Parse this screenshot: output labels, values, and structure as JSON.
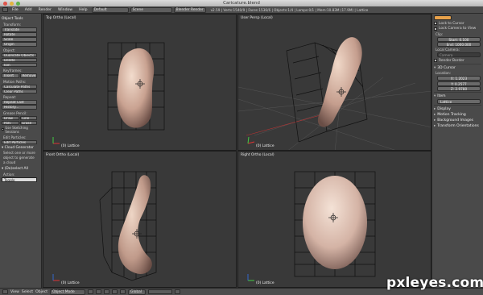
{
  "window": {
    "title": "Caricature.blend"
  },
  "header": {
    "menus": [
      "File",
      "Add",
      "Render",
      "Window",
      "Help"
    ],
    "layout": "Default",
    "scene": "Scene",
    "engine": "Blender Render",
    "stats": "v2.59 | Verts:1540/9 | Faces:1536/6 | Objects:1/4 | Lamps:0/1 | Mem:10.83M (17.9M) | Lattice"
  },
  "shelf": {
    "title": "Object Tools",
    "transform_label": "Transform:",
    "transform": [
      "Translate",
      "Rotate",
      "Scale",
      "Origin"
    ],
    "object_label": "Object:",
    "object": [
      "Duplicate Objects",
      "Delete",
      "Join"
    ],
    "keyframes_label": "Keyframes:",
    "insert": "Insert",
    "remove": "Remove",
    "motion_label": "Motion Paths:",
    "motion": [
      "Calculate Paths",
      "Clear Paths"
    ],
    "repeat_label": "Repeat:",
    "repeat": [
      "Repeat Last",
      "History..."
    ],
    "grease_label": "Grease Pencil:",
    "draw": "Draw",
    "line": "Line",
    "poly": "Poly",
    "erase": "Erase",
    "sketch": "Use Sketching Sessions",
    "edit_label": "Edit Particles:",
    "edit_particles": "Edit Particles",
    "cloud_title": "Cloud Generator",
    "cloud_msg": [
      "Select one or more",
      "object to generate",
      "a cloud"
    ],
    "deselect_title": "(De)select All",
    "action_label": "Action:",
    "action_value": "Toggle"
  },
  "viewports": [
    {
      "label": "Top Ortho (Local)",
      "object": "(0) Lattice"
    },
    {
      "label": "User Persp (Local)",
      "object": "(0) Lattice"
    },
    {
      "label": "Front Ortho (Local)",
      "object": "(0) Lattice"
    },
    {
      "label": "Right Ortho (Local)",
      "object": "(0) Lattice"
    }
  ],
  "props": {
    "lock_cursor": "Lock to Cursor",
    "lock_camera": "Lock Camera to View",
    "clip_label": "Clip:",
    "clip_start": "Start: 0.100",
    "clip_end": "End: 1000.000",
    "local_camera_label": "Local Camera:",
    "camera": "Camera",
    "render_border": "Render Border",
    "cursor_title": "3D Cursor",
    "location_label": "Location:",
    "x": "X: 1.2023",
    "y": "Y: 0.2577",
    "z": "Z: 2.9780",
    "item_title": "Item",
    "item_name": "Lattice",
    "sections": [
      "Display",
      "Motion Tracking",
      "Background Images",
      "Transform Orientations"
    ]
  },
  "footer": {
    "view": "View",
    "select": "Select",
    "object": "Object",
    "mode": "Object Mode",
    "pivot": "Global"
  },
  "watermark": "pxleyes.com"
}
